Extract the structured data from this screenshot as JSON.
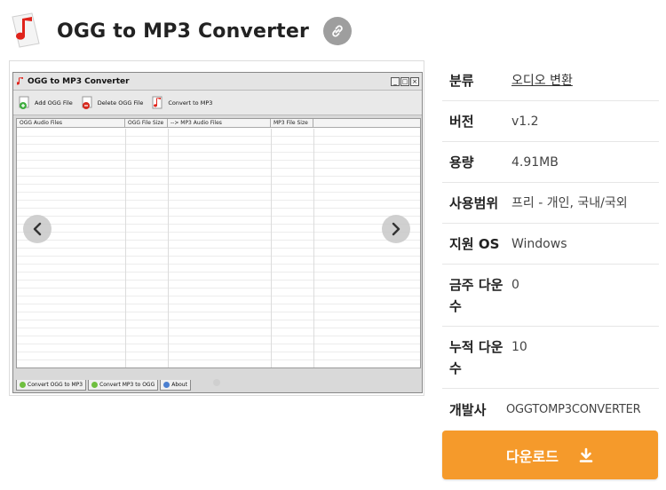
{
  "header": {
    "title": "OGG to MP3 Converter",
    "logo_icon": "music-note-doc-icon",
    "link_icon": "link-icon"
  },
  "screenshot": {
    "window_title": "OGG to MP3 Converter",
    "toolbar": {
      "add": "Add OGG File",
      "delete": "Delete OGG File",
      "convert": "Convert to MP3"
    },
    "columns": [
      "OGG Audio Files",
      "OGG File Size",
      "--> MP3 Audio Files",
      "MP3 File Size"
    ],
    "tabs": [
      "Convert OGG to MP3",
      "Convert MP3 to OGG",
      "About"
    ]
  },
  "info": {
    "category_label": "분류",
    "category_value": "오디오 변환",
    "version_label": "버전",
    "version_value": "v1.2",
    "size_label": "용량",
    "size_value": "4.91MB",
    "license_label": "사용범위",
    "license_value": "프리 - 개인, 국내/국외",
    "os_label": "지원 OS",
    "os_value": "Windows",
    "weekly_label": "금주 다운수",
    "weekly_value": "0",
    "total_label": "누적 다운수",
    "total_value": "10",
    "dev_label": "개발사",
    "dev_value": "OGGTOMP3CONVERTER"
  },
  "download": {
    "label": "다운로드",
    "icon": "download-icon"
  },
  "colors": {
    "accent": "#f59a2b",
    "link_btn": "#9e9e9e",
    "logo_red": "#e0231b"
  }
}
